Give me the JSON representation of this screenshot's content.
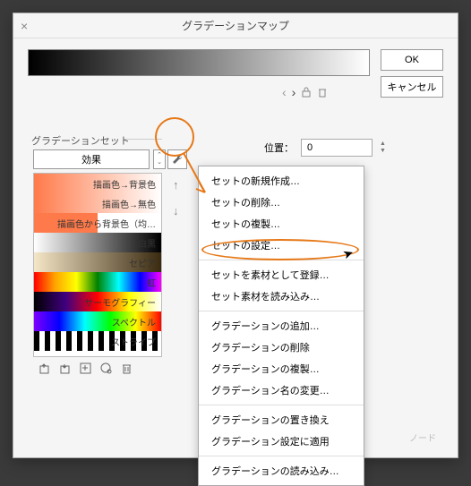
{
  "title": "グラデーションマップ",
  "buttons": {
    "ok": "OK",
    "cancel": "キャンセル"
  },
  "position": {
    "label": "位置：",
    "value": "0"
  },
  "section": {
    "label": "グラデーションセット",
    "effect": "効果"
  },
  "gradients": [
    {
      "name": "描画色→背景色",
      "css": "linear-gradient(to right,#ff7a4a,#fff)"
    },
    {
      "name": "描画色→無色",
      "css": "linear-gradient(to right,#ff7a4a,rgba(255,122,74,0))"
    },
    {
      "name": "描画色から背景色（均…",
      "css": "linear-gradient(to right,#ff7a4a 50%,#fff 50%)"
    },
    {
      "name": "白黒",
      "css": "linear-gradient(to right,#fff,#000)"
    },
    {
      "name": "セピア",
      "css": "linear-gradient(to right,#f5e6c8,#3a2a10)"
    },
    {
      "name": "虹",
      "css": "linear-gradient(to right,red,orange,yellow,green,cyan,blue,magenta)"
    },
    {
      "name": "サーモグラフィー",
      "css": "linear-gradient(to right,#000,#400080,#ff0000,#ffff00,#fff)"
    },
    {
      "name": "スペクトル",
      "css": "linear-gradient(to right,#8000ff,#0000ff,#00ffff,#00ff00,#ffff00,#ff0000)"
    },
    {
      "name": "ストライプ",
      "css": "repeating-linear-gradient(to right,#000 0 6px,#fff 6px 12px)"
    }
  ],
  "menu": {
    "group1": [
      "セットの新規作成…",
      "セットの削除…",
      "セットの複製…",
      "セットの設定…"
    ],
    "group2": [
      "セットを素材として登録…",
      "セット素材を読み込み…"
    ],
    "group3": [
      "グラデーションの追加…",
      "グラデーションの削除",
      "グラデーションの複製…",
      "グラデーション名の変更…"
    ],
    "group4": [
      "グラデーションの置き換え",
      "グラデーション設定に適用"
    ],
    "group5": [
      "グラデーションの読み込み…"
    ]
  },
  "ghost": "ノード"
}
